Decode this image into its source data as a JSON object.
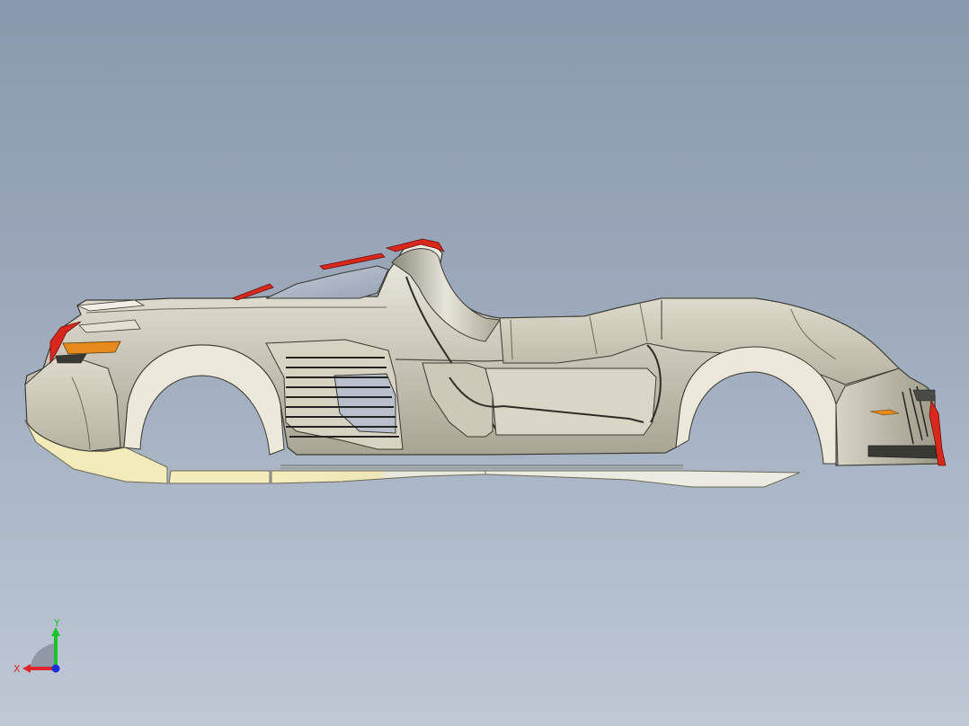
{
  "viewport": {
    "background_top": "#8a99ad",
    "background_bottom": "#bfc8d5"
  },
  "model": {
    "body_color": "#c8c4b4",
    "accent_color": "#d8281e",
    "floor_color": "#f3eab8",
    "glass_color": "#aeb8c9",
    "lamp_color": "#e8891c"
  },
  "triad": {
    "x_label": "X",
    "y_label": "Y",
    "x_color": "#e0262a",
    "y_color": "#17c42a",
    "z_color": "#1a2fd8"
  }
}
